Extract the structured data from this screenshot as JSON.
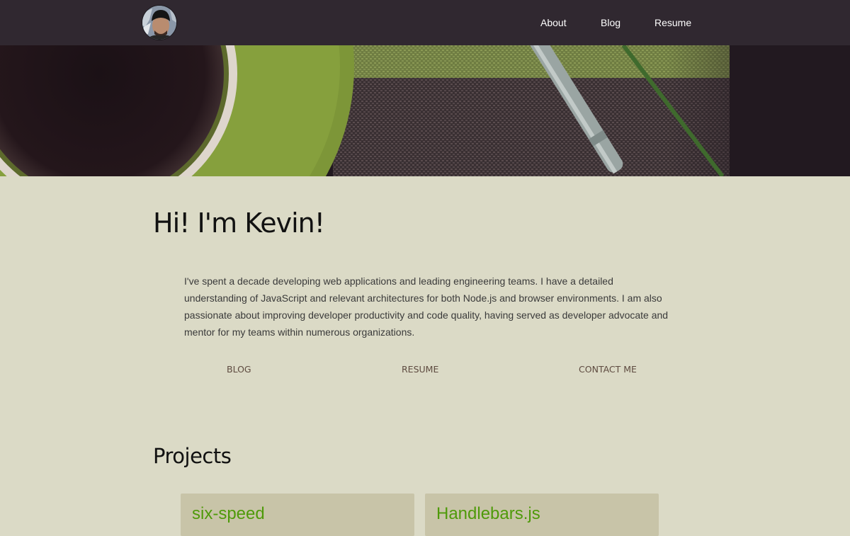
{
  "nav": {
    "avatar_alt": "Kevin",
    "links": [
      {
        "label": "About"
      },
      {
        "label": "Blog"
      },
      {
        "label": "Resume"
      }
    ]
  },
  "intro": {
    "title": "Hi! I'm Kevin!",
    "text": "I've spent a decade developing web applications and leading engineering teams. I have a detailed understanding of JavaScript and relevant architectures for both Node.js and browser environments. I am also passionate about improving developer productivity and code quality, having served as developer advocate and mentor for my teams within numerous organizations.",
    "actions": [
      {
        "label": "BLOG"
      },
      {
        "label": "RESUME"
      },
      {
        "label": "CONTACT ME"
      }
    ]
  },
  "projects": {
    "title": "Projects",
    "items": [
      {
        "name": "six-speed"
      },
      {
        "name": "Handlebars.js"
      }
    ]
  },
  "colors": {
    "topbar": "#302830",
    "page_background": "#dbdac6",
    "card_background": "#c8c4a8",
    "project_link": "#4f9a0a",
    "action_link": "#5e4b40"
  }
}
